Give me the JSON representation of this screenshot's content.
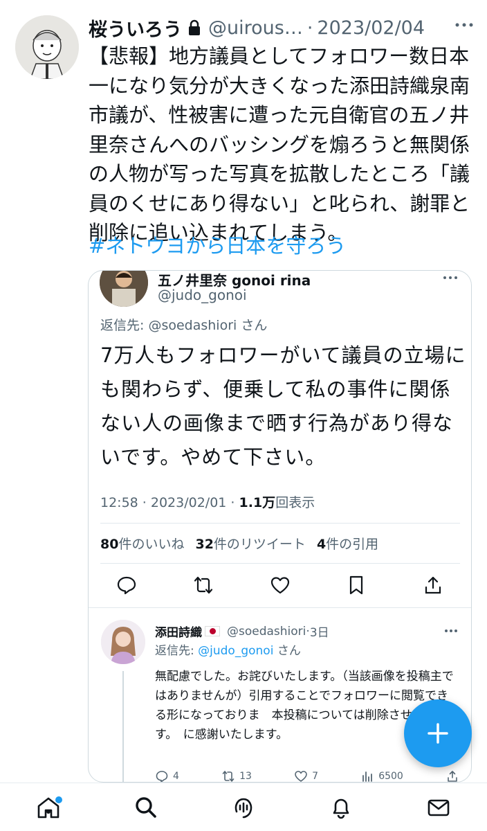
{
  "main_tweet": {
    "author_name": "桜ういろう",
    "handle": "@uirous…",
    "separator": "·",
    "date": "2023/02/04",
    "body": "【悲報】地方議員としてフォロワー数日本一になり気分が大きくなった添田詩織泉南市議が、性被害に遭った元自衛官の五ノ井里奈さんへのバッシングを煽ろうと無関係の人物が写った写真を拡散したところ「議員のくせにあり得ない」と叱られ、謝罪と削除に追い込まれてしまう。",
    "hashtag": "#ネトウヨから日本を守ろう"
  },
  "quoted_tweet": {
    "author_name": "五ノ井里奈 gonoi rina",
    "handle": "@judo_gonoi",
    "reply_prefix": "返信先: ",
    "reply_to": "@soedashiori",
    "reply_suffix": " さん",
    "body": "7万人もフォロワーがいて議員の立場にも関わらず、便乗して私の事件に関係ない人の画像まで晒す行為があり得ないです。やめて下さい。",
    "time": "12:58 · 2023/02/01 · ",
    "views": "1.1万",
    "views_label": "回表示",
    "likes": "80",
    "likes_label": "件のいいね",
    "retweets": "32",
    "retweets_label": "件のリツイート",
    "quotes": "4",
    "quotes_label": "件の引用"
  },
  "reply_tweet": {
    "author_name": "添田詩織",
    "handle": "@soedashiori",
    "separator": "·",
    "age": "3日",
    "reply_prefix": "返信先: ",
    "reply_to": "@judo_gonoi",
    "reply_suffix": " さん",
    "body": "無配慮でした。お詫びいたします。（当該画像を投稿主ではありませんが）引用することでフォロワーに閲覧できる形になっておりま　本投稿については削除させて頂きます。　に感謝いたします。",
    "replies": "4",
    "retweets": "13",
    "likes": "7",
    "views": "6500"
  },
  "tabs": [
    "home-icon",
    "search-icon",
    "spaces-icon",
    "notifications-icon",
    "messages-icon"
  ],
  "colors": {
    "accent": "#1d9bf0",
    "text": "#0f1419",
    "muted": "#536471",
    "border": "#cfd9de"
  }
}
